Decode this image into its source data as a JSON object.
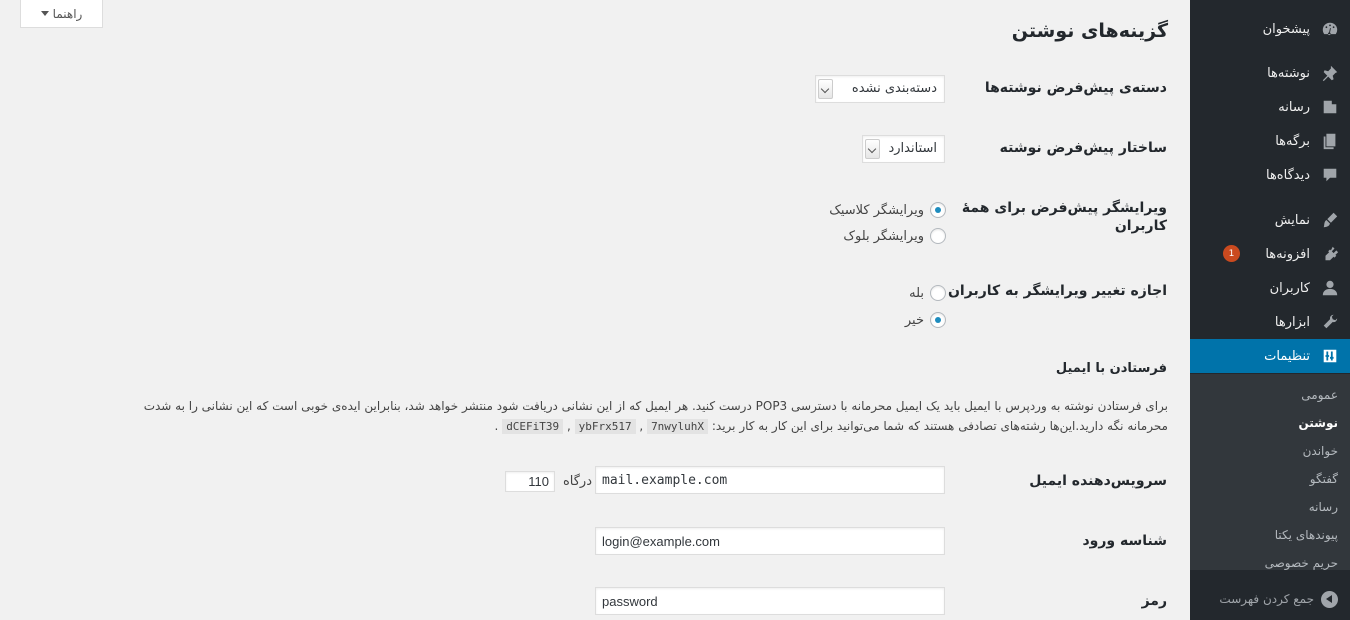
{
  "help_tab": {
    "label": "راهنما"
  },
  "sidebar": {
    "items": [
      {
        "label": "پیشخوان",
        "icon": "dashboard-icon"
      },
      {
        "label": "نوشته‌ها",
        "icon": "pin-icon"
      },
      {
        "label": "رسانه",
        "icon": "media-icon"
      },
      {
        "label": "برگه‌ها",
        "icon": "pages-icon"
      },
      {
        "label": "دیدگاه‌ها",
        "icon": "comment-icon"
      },
      {
        "label": "نمایش",
        "icon": "brush-icon"
      },
      {
        "label": "افزونه‌ها",
        "icon": "plugin-icon",
        "badge": "1"
      },
      {
        "label": "کاربران",
        "icon": "user-icon"
      },
      {
        "label": "ابزارها",
        "icon": "wrench-icon"
      },
      {
        "label": "تنظیمات",
        "icon": "settings-icon",
        "active": true
      }
    ],
    "submenu": [
      "عمومی",
      "نوشتن",
      "خواندن",
      "گفتگو",
      "رسانه",
      "پیوندهای یکتا",
      "حریم خصوصی"
    ],
    "current_submenu": "نوشتن",
    "collapse_label": "جمع کردن فهرست"
  },
  "page": {
    "title": "گزینه‌های نوشتن",
    "default_category": {
      "label": "دسته‌ی پیش‌فرض نوشته‌ها",
      "value": "دسته‌بندی نشده"
    },
    "default_format": {
      "label": "ساختار پیش‌فرض نوشته",
      "value": "استاندارد"
    },
    "default_editor": {
      "label_line1": "ویرایشگر پیش‌فرض برای همهٔ",
      "label_line2": "کاربران",
      "options": [
        "ویرایشگر کلاسیک",
        "ویرایشگر بلوک"
      ],
      "selected": "ویرایشگر کلاسیک"
    },
    "allow_switch": {
      "label": "اجازه تغییر ویرایشگر به کاربران",
      "options": [
        "بله",
        "خیر"
      ],
      "selected": "خیر"
    },
    "post_via_email": {
      "heading": "فرستادن با ایمیل",
      "description_line1": "برای فرستادن نوشته به وردپرس با ایمیل باید یک ایمیل محرمانه با دسترسی POP3 درست کنید. هر ایمیل که از این نشانی دریافت شود منتشر خواهد شد، بنابراین ایده‌ی خوبی است که این نشانی را به شدت",
      "description_line2": "محرمانه نگه دارید.این‌ها رشته‌های تصادفی هستند که شما می‌توانید برای این کار به کار برید:",
      "random_strings": [
        "dCEFiT39",
        "ybFrx517",
        "7nwyluhX"
      ],
      "server_label": "سرویس‌دهنده ایمیل",
      "server_value": "mail.example.com",
      "port_label": "درگاه",
      "port_value": "110",
      "login_label": "شناسه ورود",
      "login_value": "login@example.com",
      "password_label": "رمز",
      "password_value": "password"
    }
  },
  "colors": {
    "sidebar_bg": "#23282d",
    "active_bg": "#0073aa",
    "submenu_bg": "#32373c",
    "badge": "#ca4a1f",
    "page_bg": "#f1f1f1"
  }
}
